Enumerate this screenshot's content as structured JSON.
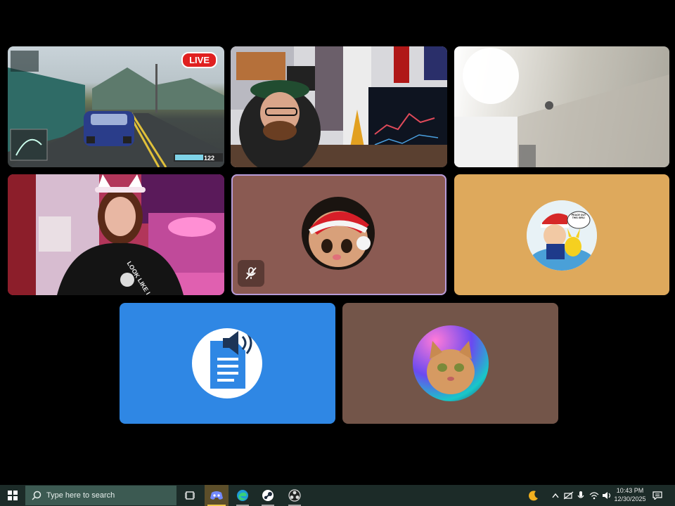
{
  "tiles": {
    "race_game": {
      "live_badge": "LIVE",
      "speed": "122"
    },
    "streamer_office": {},
    "camera_ceiling": {},
    "streamer_bedroom": {
      "shirt_text": "LOOK LIKE I CA"
    },
    "cat_santa_avatar": {
      "muted": true,
      "bg": "#8a5a52"
    },
    "ash_avatar": {
      "bubble_text": "PEACE OUT THIS GIRL!",
      "bg": "#dea95c"
    },
    "tts_bot": {
      "bg": "#2f87e4"
    },
    "rainbow_cat_avatar": {
      "bg": "#735549"
    }
  },
  "taskbar": {
    "search_placeholder": "Type here to search",
    "apps": [
      "task-view",
      "discord",
      "edge",
      "steam",
      "obs"
    ],
    "tray": {
      "time": "10:43 PM",
      "date": "12/30/2025"
    }
  }
}
